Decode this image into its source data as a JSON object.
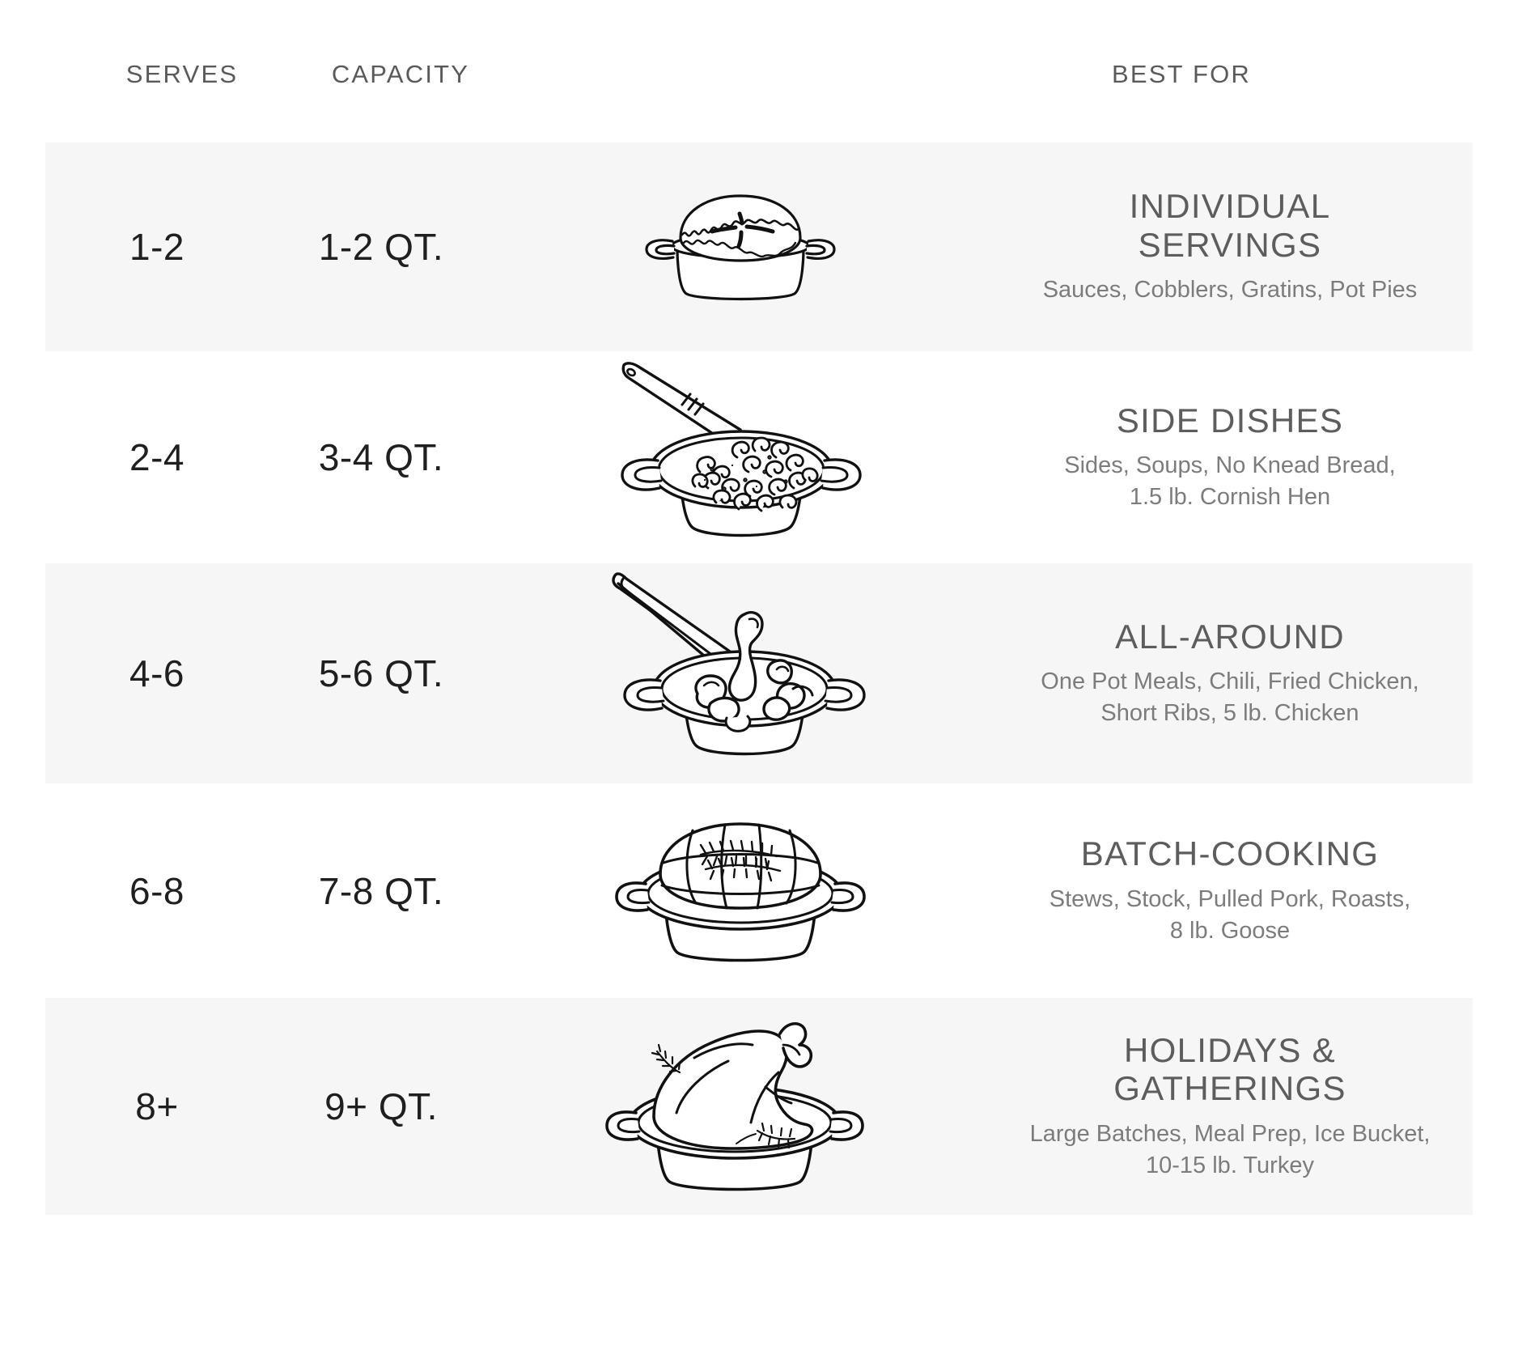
{
  "header": {
    "serves_label": "SERVES",
    "capacity_label": "CAPACITY",
    "best_for_label": "BEST FOR"
  },
  "colors": {
    "page_background": "#ffffff",
    "stripe_background": "#f6f6f6",
    "header_text": "#5a5a5a",
    "value_text": "#1f1f1f",
    "best_title_text": "#5d5d5d",
    "best_sub_text": "#7c7c7c",
    "illustration_stroke": "#111111"
  },
  "rows": [
    {
      "serves": "1-2",
      "capacity": "1-2 QT.",
      "illustration": "pot-pie-icon",
      "best_title": "INDIVIDUAL\nSERVINGS",
      "best_sub": "Sauces, Cobblers, Gratins, Pot Pies"
    },
    {
      "serves": "2-4",
      "capacity": "3-4 QT.",
      "illustration": "mac-and-cheese-pot-icon",
      "best_title": "SIDE DISHES",
      "best_sub": "Sides, Soups, No Knead Bread,\n1.5 lb. Cornish Hen"
    },
    {
      "serves": "4-6",
      "capacity": "5-6 QT.",
      "illustration": "fried-chicken-tongs-pot-icon",
      "best_title": "ALL-AROUND",
      "best_sub": "One Pot Meals, Chili, Fried Chicken,\nShort Ribs, 5 lb. Chicken"
    },
    {
      "serves": "6-8",
      "capacity": "7-8 QT.",
      "illustration": "trussed-roast-pot-icon",
      "best_title": "BATCH-COOKING",
      "best_sub": "Stews, Stock, Pulled Pork, Roasts,\n8 lb. Goose"
    },
    {
      "serves": "8+",
      "capacity": "9+ QT.",
      "illustration": "whole-turkey-pot-icon",
      "best_title": "HOLIDAYS &\nGATHERINGS",
      "best_sub": "Large Batches, Meal Prep, Ice Bucket,\n10-15 lb. Turkey"
    }
  ]
}
